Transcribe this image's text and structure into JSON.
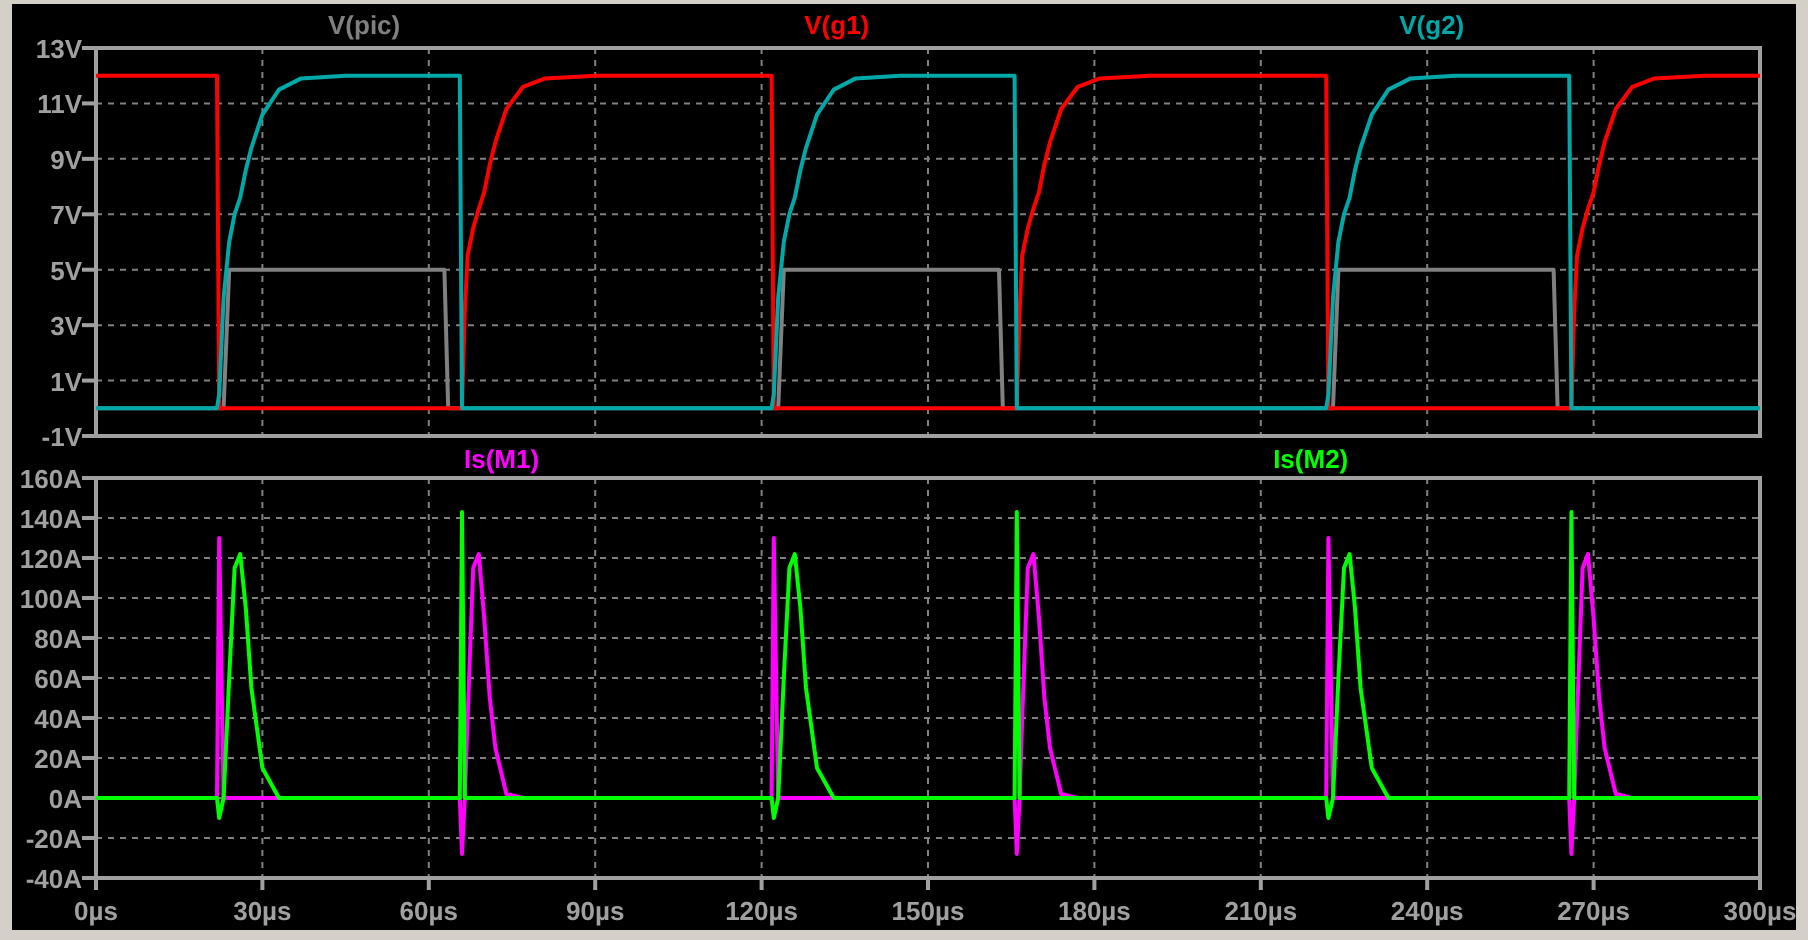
{
  "panes": [
    {
      "chart_data": {
        "type": "line",
        "grid": true,
        "xlim": [
          0,
          300
        ],
        "ylim": [
          -1,
          13
        ],
        "yticks": [
          {
            "value": 13,
            "label": "13V"
          },
          {
            "value": 11,
            "label": "11V"
          },
          {
            "value": 9,
            "label": "9V"
          },
          {
            "value": 7,
            "label": "7V"
          },
          {
            "value": 5,
            "label": "5V"
          },
          {
            "value": 3,
            "label": "3V"
          },
          {
            "value": 1,
            "label": "1V"
          },
          {
            "value": -1,
            "label": "-1V"
          }
        ],
        "x": [
          0,
          21.8,
          22.2,
          23,
          24,
          25,
          26,
          27,
          28,
          30,
          33,
          37,
          45,
          62.8,
          63.5,
          65.6,
          66,
          66.5,
          67,
          68,
          69,
          70,
          71,
          72,
          74,
          77,
          81,
          90,
          100,
          121.8,
          122.2,
          123,
          124,
          125,
          126,
          127,
          128,
          130,
          133,
          137,
          145,
          162.8,
          163.5,
          165.6,
          166,
          166.5,
          167,
          168,
          169,
          170,
          171,
          172,
          174,
          177,
          181,
          190,
          200,
          221.8,
          222.2,
          223,
          224,
          225,
          226,
          227,
          228,
          230,
          233,
          237,
          245,
          262.8,
          263.5,
          265.6,
          266,
          266.5,
          267,
          268,
          269,
          270,
          271,
          272,
          274,
          277,
          281,
          290,
          300
        ],
        "series": [
          {
            "name": "V(pic)",
            "color": "#808080",
            "values": [
              0,
              0,
              0,
              0,
              5,
              5,
              5,
              5,
              5,
              5,
              5,
              5,
              5,
              5,
              0,
              0,
              0,
              0,
              0,
              0,
              0,
              0,
              0,
              0,
              0,
              0,
              0,
              0,
              0,
              0,
              0,
              0,
              5,
              5,
              5,
              5,
              5,
              5,
              5,
              5,
              5,
              5,
              0,
              0,
              0,
              0,
              0,
              0,
              0,
              0,
              0,
              0,
              0,
              0,
              0,
              0,
              0,
              0,
              0,
              0,
              5,
              5,
              5,
              5,
              5,
              5,
              5,
              5,
              5,
              5,
              0,
              0,
              0,
              0,
              0,
              0,
              0,
              0,
              0,
              0,
              0,
              0,
              0,
              0,
              0
            ]
          },
          {
            "name": "V(g1)",
            "color": "#ff0000",
            "values": [
              12,
              12,
              0,
              0,
              0,
              0,
              0,
              0,
              0,
              0,
              0,
              0,
              0,
              0,
              0,
              0,
              0,
              3.5,
              5.5,
              6.5,
              7.2,
              7.8,
              8.8,
              9.6,
              10.8,
              11.6,
              11.9,
              12,
              12,
              12,
              0,
              0,
              0,
              0,
              0,
              0,
              0,
              0,
              0,
              0,
              0,
              0,
              0,
              0,
              0,
              3.5,
              5.5,
              6.5,
              7.2,
              7.8,
              8.8,
              9.6,
              10.8,
              11.6,
              11.9,
              12,
              12,
              12,
              0,
              0,
              0,
              0,
              0,
              0,
              0,
              0,
              0,
              0,
              0,
              0,
              0,
              0,
              0,
              3.5,
              5.5,
              6.5,
              7.2,
              7.8,
              8.8,
              9.6,
              10.8,
              11.6,
              11.9,
              12,
              12
            ]
          },
          {
            "name": "V(g2)",
            "color": "#00a8a8",
            "values": [
              0,
              0,
              0.5,
              4,
              6,
              7,
              7.6,
              8.6,
              9.4,
              10.6,
              11.5,
              11.9,
              12,
              12,
              12,
              12,
              0,
              0,
              0,
              0,
              0,
              0,
              0,
              0,
              0,
              0,
              0,
              0,
              0,
              0,
              0.5,
              4,
              6,
              7,
              7.6,
              8.6,
              9.4,
              10.6,
              11.5,
              11.9,
              12,
              12,
              12,
              12,
              0,
              0,
              0,
              0,
              0,
              0,
              0,
              0,
              0,
              0,
              0,
              0,
              0,
              0,
              0.5,
              4,
              6,
              7,
              7.6,
              8.6,
              9.4,
              10.6,
              11.5,
              11.9,
              12,
              12,
              12,
              12,
              0,
              0,
              0,
              0,
              0,
              0,
              0,
              0,
              0,
              0,
              0,
              0,
              0
            ]
          }
        ]
      }
    },
    {
      "chart_data": {
        "type": "line",
        "grid": true,
        "xlim": [
          0,
          300
        ],
        "ylim": [
          -40,
          160
        ],
        "xticks": [
          {
            "value": 0,
            "label": "0µs"
          },
          {
            "value": 30,
            "label": "30µs"
          },
          {
            "value": 60,
            "label": "60µs"
          },
          {
            "value": 90,
            "label": "90µs"
          },
          {
            "value": 120,
            "label": "120µs"
          },
          {
            "value": 150,
            "label": "150µs"
          },
          {
            "value": 180,
            "label": "180µs"
          },
          {
            "value": 210,
            "label": "210µs"
          },
          {
            "value": 240,
            "label": "240µs"
          },
          {
            "value": 270,
            "label": "270µs"
          },
          {
            "value": 300,
            "label": "300µs"
          }
        ],
        "yticks": [
          {
            "value": 160,
            "label": "160A"
          },
          {
            "value": 140,
            "label": "140A"
          },
          {
            "value": 120,
            "label": "120A"
          },
          {
            "value": 100,
            "label": "100A"
          },
          {
            "value": 80,
            "label": "80A"
          },
          {
            "value": 60,
            "label": "60A"
          },
          {
            "value": 40,
            "label": "40A"
          },
          {
            "value": 20,
            "label": "20A"
          },
          {
            "value": 0,
            "label": "0A"
          },
          {
            "value": -20,
            "label": "-20A"
          },
          {
            "value": -40,
            "label": "-40A"
          }
        ],
        "x": [
          0,
          21.8,
          22.2,
          23,
          24,
          25,
          26,
          27,
          28,
          30,
          33,
          37,
          45,
          62.8,
          63.5,
          65.6,
          66,
          66.5,
          67,
          68,
          69,
          70,
          71,
          72,
          74,
          77,
          81,
          90,
          100,
          121.8,
          122.2,
          123,
          124,
          125,
          126,
          127,
          128,
          130,
          133,
          137,
          145,
          162.8,
          163.5,
          165.6,
          166,
          166.5,
          167,
          168,
          169,
          170,
          171,
          172,
          174,
          177,
          181,
          190,
          200,
          221.8,
          222.2,
          223,
          224,
          225,
          226,
          227,
          228,
          230,
          233,
          237,
          245,
          262.8,
          263.5,
          265.6,
          266,
          266.5,
          267,
          268,
          269,
          270,
          271,
          272,
          274,
          277,
          281,
          290,
          300
        ],
        "series": [
          {
            "name": "Is(M1)",
            "color": "#ff00ff",
            "values": [
              0,
              0,
              130,
              0,
              0,
              0,
              0,
              0,
              0,
              0,
              0,
              0,
              0,
              0,
              0,
              0,
              -28,
              0,
              40,
              115,
              122,
              90,
              50,
              25,
              2,
              0,
              0,
              0,
              0,
              0,
              130,
              0,
              0,
              0,
              0,
              0,
              0,
              0,
              0,
              0,
              0,
              0,
              0,
              0,
              -28,
              0,
              40,
              115,
              122,
              90,
              50,
              25,
              2,
              0,
              0,
              0,
              0,
              0,
              130,
              0,
              0,
              0,
              0,
              0,
              0,
              0,
              0,
              0,
              0,
              0,
              0,
              0,
              -28,
              0,
              40,
              115,
              122,
              90,
              50,
              25,
              2,
              0,
              0,
              null,
              null
            ]
          },
          {
            "name": "Is(M2)",
            "color": "#00ff00",
            "values": [
              0,
              0,
              -10,
              0,
              60,
              115,
              122,
              95,
              55,
              15,
              0,
              0,
              0,
              0,
              0,
              0,
              143,
              0,
              0,
              0,
              0,
              0,
              0,
              0,
              0,
              0,
              0,
              0,
              0,
              0,
              -10,
              0,
              60,
              115,
              122,
              95,
              55,
              15,
              0,
              0,
              0,
              0,
              0,
              0,
              143,
              0,
              0,
              0,
              0,
              0,
              0,
              0,
              0,
              0,
              0,
              0,
              0,
              0,
              -10,
              0,
              60,
              115,
              122,
              95,
              55,
              15,
              0,
              0,
              0,
              0,
              0,
              0,
              143,
              0,
              0,
              0,
              0,
              0,
              0,
              0,
              0,
              0,
              0,
              0,
              0
            ]
          }
        ]
      }
    }
  ]
}
